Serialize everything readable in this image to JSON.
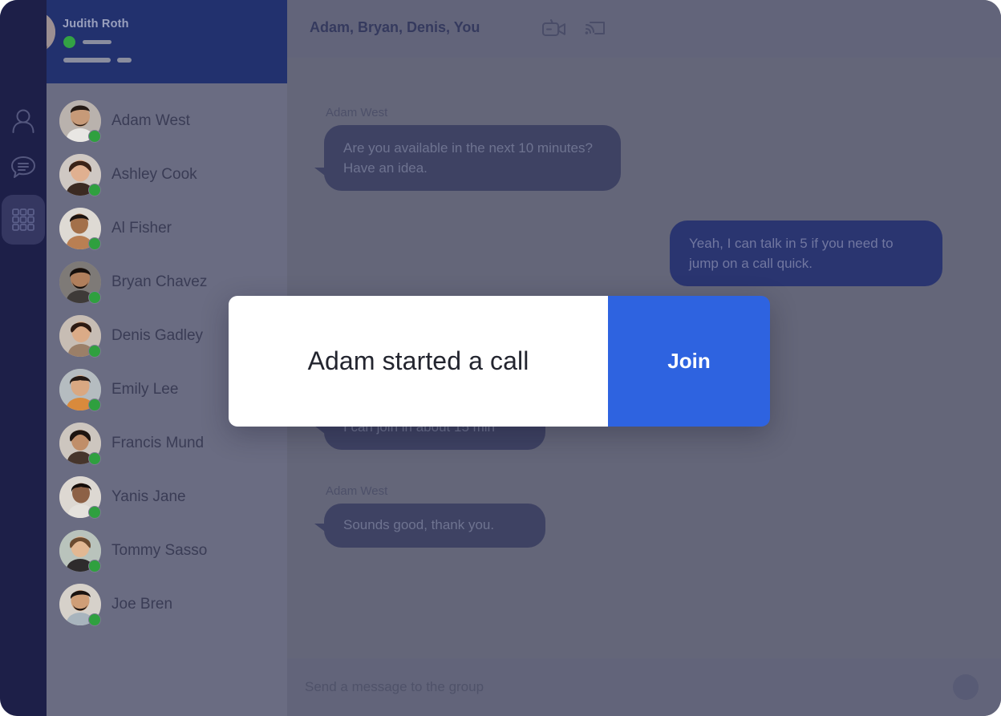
{
  "nav_rail": {
    "items": [
      {
        "name": "contacts",
        "icon": "person-icon",
        "selected": false
      },
      {
        "name": "chats",
        "icon": "chat-bubble-icon",
        "selected": false
      },
      {
        "name": "apps",
        "icon": "grid-apps-icon",
        "selected": true
      }
    ]
  },
  "profile": {
    "name": "Judith Roth",
    "status": "online",
    "status_color": "#33a244"
  },
  "contacts": {
    "items": [
      {
        "name": "Adam West",
        "status": "online"
      },
      {
        "name": "Ashley Cook",
        "status": "online"
      },
      {
        "name": "Al Fisher",
        "status": "online"
      },
      {
        "name": "Bryan Chavez",
        "status": "online"
      },
      {
        "name": "Denis Gadley",
        "status": "online"
      },
      {
        "name": "Emily Lee",
        "status": "online"
      },
      {
        "name": "Francis Mund",
        "status": "online"
      },
      {
        "name": "Yanis Jane",
        "status": "online"
      },
      {
        "name": "Tommy Sasso",
        "status": "online"
      },
      {
        "name": "Joe Bren",
        "status": "online"
      }
    ]
  },
  "chat": {
    "title": "Adam, Bryan, Denis, You",
    "video_call_icon": "video-camera-icon",
    "cast_icon": "screencast-icon",
    "messages": [
      {
        "sender": "Adam West",
        "text": "Are you available in the next 10 minutes? Have an idea.",
        "direction": "incoming"
      },
      {
        "sender": "",
        "text": "Yeah, I can talk in 5 if you need to jump on a call quick.",
        "direction": "outgoing"
      },
      {
        "sender": "",
        "text": "I can join in about 15 min",
        "direction": "incoming"
      },
      {
        "sender": "Adam West",
        "text": "Sounds good, thank you.",
        "direction": "incoming"
      }
    ]
  },
  "composer": {
    "placeholder": "Send a message to the group",
    "value": "",
    "send_icon": "send-button-icon"
  },
  "modal": {
    "message": "Adam started a call",
    "join_label": "Join",
    "accent_color": "#2e63e0"
  }
}
